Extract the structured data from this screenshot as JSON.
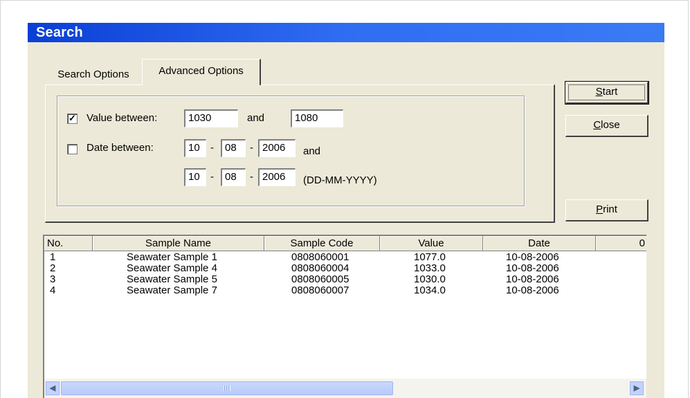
{
  "window": {
    "title": "Search"
  },
  "tabs": [
    {
      "label": "Search Options",
      "active": false
    },
    {
      "label": "Advanced Options",
      "active": true
    }
  ],
  "value_filter": {
    "checked": true,
    "label": "Value between:",
    "from": "1030",
    "and_label": "and",
    "to": "1080"
  },
  "date_filter": {
    "checked": false,
    "label": "Date between:",
    "from": {
      "day": "10",
      "month": "08",
      "year": "2006"
    },
    "and_label": "and",
    "to": {
      "day": "10",
      "month": "08",
      "year": "2006"
    },
    "separator": "-",
    "format_hint": "(DD-MM-YYYY)"
  },
  "buttons": {
    "start": {
      "mnemonic": "S",
      "rest": "tart"
    },
    "close": {
      "mnemonic": "C",
      "rest": "lose"
    },
    "print": {
      "mnemonic": "P",
      "rest": "rint"
    }
  },
  "results": {
    "columns": [
      "No.",
      "Sample Name",
      "Sample Code",
      "Value",
      "Date",
      "0"
    ],
    "rows": [
      [
        "1",
        "Seawater Sample 1",
        "0808060001",
        "1077.0",
        "10-08-2006"
      ],
      [
        "2",
        "Seawater Sample 4",
        "0808060004",
        "1033.0",
        "10-08-2006"
      ],
      [
        "3",
        "Seawater Sample 5",
        "0808060005",
        "1030.0",
        "10-08-2006"
      ],
      [
        "4",
        "Seawater Sample 7",
        "0808060007",
        "1034.0",
        "10-08-2006"
      ]
    ]
  },
  "scrollbar": {
    "left_icon": "scroll-left-arrow",
    "right_icon": "scroll-right-arrow"
  }
}
